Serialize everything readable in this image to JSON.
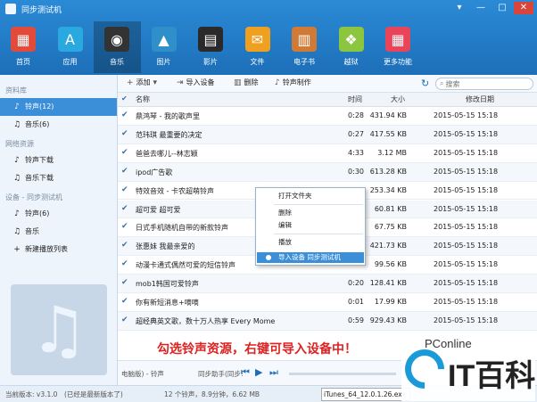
{
  "app": {
    "title": "同步测试机",
    "window_buttons": [
      "▾",
      "—",
      "□",
      "✕"
    ]
  },
  "nav": [
    {
      "label": "首页",
      "icon": "home-icon",
      "glyph": "▦",
      "color": "#e24b3c"
    },
    {
      "label": "应用",
      "icon": "appstore-icon",
      "glyph": "A",
      "color": "#2aa9e0"
    },
    {
      "label": "音乐",
      "icon": "music-icon",
      "glyph": "◉",
      "color": "#333333"
    },
    {
      "label": "图片",
      "icon": "picture-icon",
      "glyph": "▲",
      "color": "#2e8fc9"
    },
    {
      "label": "影片",
      "icon": "movie-icon",
      "glyph": "▤",
      "color": "#2a2a2a"
    },
    {
      "label": "文件",
      "icon": "file-icon",
      "glyph": "✉",
      "color": "#f0a020"
    },
    {
      "label": "电子书",
      "icon": "ebook-icon",
      "glyph": "▥",
      "color": "#d07a35"
    },
    {
      "label": "越狱",
      "icon": "jailbreak-icon",
      "glyph": "❖",
      "color": "#8cc63f"
    },
    {
      "label": "更多功能",
      "icon": "more-icon",
      "glyph": "▦",
      "color": "#e8455a"
    }
  ],
  "sidebar": {
    "library_header": "资料库",
    "library_items": [
      {
        "label": "铃声(12)",
        "icon": "bell-icon",
        "glyph": "🔔",
        "selected": true
      },
      {
        "label": "音乐(6)",
        "icon": "music-note-icon",
        "glyph": "♫",
        "selected": false
      }
    ],
    "network_header": "网络资源",
    "network_items": [
      {
        "label": "铃声下载",
        "icon": "bell-icon",
        "glyph": "🔔"
      },
      {
        "label": "音乐下载",
        "icon": "music-note-icon",
        "glyph": "♫"
      }
    ],
    "device_header": "设备 - 同步测试机",
    "device_items": [
      {
        "label": "铃声(6)",
        "icon": "bell-icon",
        "glyph": "🔔"
      },
      {
        "label": "音乐",
        "icon": "music-note-icon",
        "glyph": "♫"
      },
      {
        "label": "新建播放列表",
        "icon": "plus-icon",
        "glyph": "+"
      }
    ]
  },
  "toolbar": {
    "add": "添加",
    "import": "导入设备",
    "delete": "删除",
    "make_ringtone": "铃声制作",
    "search_placeholder": "搜索"
  },
  "table": {
    "headers": {
      "name": "名称",
      "time": "时间",
      "size": "大小",
      "date": "修改日期"
    },
    "rows": [
      {
        "name": "鼎鸿琴 - 我的歌声里",
        "time": "0:28",
        "size": "431.94 KB",
        "date": "2015-05-15 15:18"
      },
      {
        "name": "范玮琪 最重要的决定",
        "time": "0:27",
        "size": "417.55 KB",
        "date": "2015-05-15 15:18"
      },
      {
        "name": "爸爸去哪儿--林志颖",
        "time": "4:33",
        "size": "3.12 MB",
        "date": "2015-05-15 15:18"
      },
      {
        "name": "ipod广告歌",
        "time": "0:30",
        "size": "613.28 KB",
        "date": "2015-05-15 15:18"
      },
      {
        "name": "特效音效 - 卡农超萌铃声",
        "time": "",
        "size": "253.34 KB",
        "date": "2015-05-15 15:18"
      },
      {
        "name": "超可爱 超可爱",
        "time": "",
        "size": "60.81 KB",
        "date": "2015-05-15 15:18"
      },
      {
        "name": "日式手机随机自带的新款铃声",
        "time": "",
        "size": "67.75 KB",
        "date": "2015-05-15 15:18"
      },
      {
        "name": "张惠妹 我最亲爱的",
        "time": "",
        "size": "421.73 KB",
        "date": "2015-05-15 15:18"
      },
      {
        "name": "动漫卡通式偶然可爱的短信铃声",
        "time": "",
        "size": "99.56 KB",
        "date": "2015-05-15 15:18"
      },
      {
        "name": "mob1韩国可爱铃声",
        "time": "0:20",
        "size": "128.41 KB",
        "date": "2015-05-15 15:18"
      },
      {
        "name": "你有新短消息+嘀嘀",
        "time": "0:01",
        "size": "17.99 KB",
        "date": "2015-05-15 15:18"
      },
      {
        "name": "超经典英文歌，数十万人热享 Every Mome",
        "time": "0:59",
        "size": "929.43 KB",
        "date": "2015-05-15 15:18"
      }
    ]
  },
  "context_menu": {
    "open_folder": "打开文件夹",
    "delete": "删除",
    "edit": "编辑",
    "play": "播放",
    "import_device": "导入设备 同步测试机"
  },
  "caption": "勾选铃声资源，右键可导入设备中！",
  "player": {
    "source": "电脑版) - 铃声",
    "sync_helper": "同步助手(同步!"
  },
  "status": {
    "version": "当前版本: v3.1.0",
    "latest": "(已经是最新版本了)",
    "summary": "12 个铃声，8.9分钟，6.62 MB",
    "file": "iTunes_64_12.0.1.26.exe"
  },
  "watermark": {
    "brand": "PConline",
    "logo": "IT百科"
  }
}
